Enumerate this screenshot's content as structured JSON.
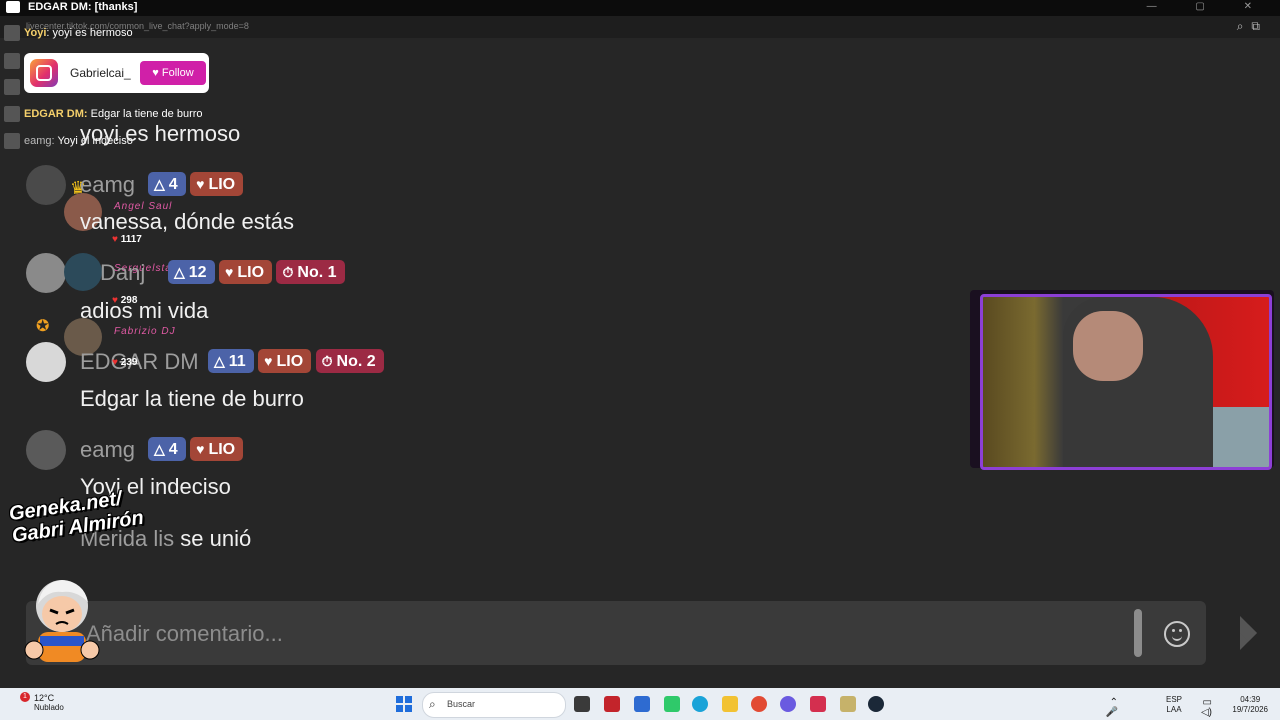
{
  "window": {
    "title": "EDGAR DM: [thanks]",
    "url": "livecenter.tiktok.com/common_live_chat?apply_mode=8"
  },
  "overlay_feed": [
    {
      "name": "Yoyi",
      "text": ": yoyi es hermoso"
    },
    {
      "name": "EDGAR DM:",
      "text": "Edgar la tiene de burro"
    },
    {
      "name": "eamg:",
      "text": "Yoyi el indeciso"
    }
  ],
  "instagram_card": {
    "username": "Gabrielcai_",
    "follow_label": "Follow"
  },
  "chat": {
    "messages": [
      {
        "text": "yoyi es hermoso"
      },
      {
        "user": "eamg",
        "level": "4",
        "fan_badge": "LIO",
        "text": "vanessa, dónde estás"
      },
      {
        "user": "Danj",
        "level": "12",
        "fan_badge": "LIO",
        "rank_badge": "No. 1",
        "text": "adios mi vida"
      },
      {
        "user": "EDGAR DM",
        "level": "11",
        "fan_badge": "LIO",
        "rank_badge": "No. 2",
        "text": "Edgar la tiene de burro"
      },
      {
        "user": "eamg",
        "level": "4",
        "fan_badge": "LIO",
        "text": "Yoyi el indeciso"
      }
    ],
    "join_event": {
      "user": "Merida lis",
      "text": "se unió"
    }
  },
  "gift_overlays": [
    {
      "name": "Angel Saul",
      "count": "1117"
    },
    {
      "name": "Serguelsta",
      "count": "298"
    },
    {
      "name": "Fabrizio DJ",
      "count": "239"
    }
  ],
  "watermark": {
    "line1": "Geneka.net/",
    "line2": "Gabri Almirón"
  },
  "input": {
    "placeholder": "Añadir comentario..."
  },
  "taskbar": {
    "temperature": "12°C",
    "weather": "Nublado",
    "notification_count": "1",
    "search_placeholder": "Buscar",
    "language_line1": "ESP",
    "language_line2": "LAA",
    "time": "04:39",
    "date": "19/7/2026"
  },
  "icons": [
    "search-icon",
    "emoji-icon",
    "send-icon",
    "heart-icon",
    "instagram-icon",
    "windows-icon"
  ],
  "colors": {
    "background": "#262626",
    "accent_purple": "#8d3fd6",
    "follow_pink": "#d020a8",
    "level_blue": "#4c63a8",
    "lio_red": "#a34637"
  }
}
